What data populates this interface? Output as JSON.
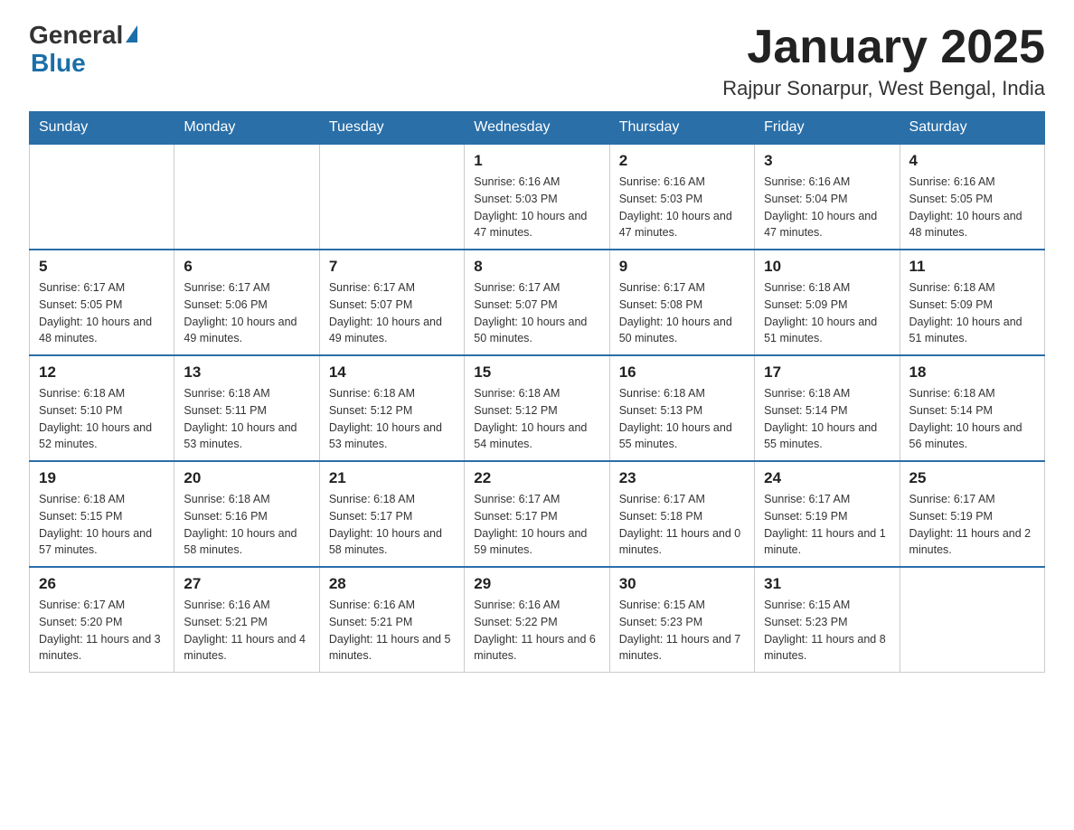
{
  "header": {
    "logo": {
      "general": "General",
      "blue": "Blue"
    },
    "title": "January 2025",
    "subtitle": "Rajpur Sonarpur, West Bengal, India"
  },
  "calendar": {
    "days_of_week": [
      "Sunday",
      "Monday",
      "Tuesday",
      "Wednesday",
      "Thursday",
      "Friday",
      "Saturday"
    ],
    "weeks": [
      [
        {
          "day": "",
          "info": ""
        },
        {
          "day": "",
          "info": ""
        },
        {
          "day": "",
          "info": ""
        },
        {
          "day": "1",
          "info": "Sunrise: 6:16 AM\nSunset: 5:03 PM\nDaylight: 10 hours and 47 minutes."
        },
        {
          "day": "2",
          "info": "Sunrise: 6:16 AM\nSunset: 5:03 PM\nDaylight: 10 hours and 47 minutes."
        },
        {
          "day": "3",
          "info": "Sunrise: 6:16 AM\nSunset: 5:04 PM\nDaylight: 10 hours and 47 minutes."
        },
        {
          "day": "4",
          "info": "Sunrise: 6:16 AM\nSunset: 5:05 PM\nDaylight: 10 hours and 48 minutes."
        }
      ],
      [
        {
          "day": "5",
          "info": "Sunrise: 6:17 AM\nSunset: 5:05 PM\nDaylight: 10 hours and 48 minutes."
        },
        {
          "day": "6",
          "info": "Sunrise: 6:17 AM\nSunset: 5:06 PM\nDaylight: 10 hours and 49 minutes."
        },
        {
          "day": "7",
          "info": "Sunrise: 6:17 AM\nSunset: 5:07 PM\nDaylight: 10 hours and 49 minutes."
        },
        {
          "day": "8",
          "info": "Sunrise: 6:17 AM\nSunset: 5:07 PM\nDaylight: 10 hours and 50 minutes."
        },
        {
          "day": "9",
          "info": "Sunrise: 6:17 AM\nSunset: 5:08 PM\nDaylight: 10 hours and 50 minutes."
        },
        {
          "day": "10",
          "info": "Sunrise: 6:18 AM\nSunset: 5:09 PM\nDaylight: 10 hours and 51 minutes."
        },
        {
          "day": "11",
          "info": "Sunrise: 6:18 AM\nSunset: 5:09 PM\nDaylight: 10 hours and 51 minutes."
        }
      ],
      [
        {
          "day": "12",
          "info": "Sunrise: 6:18 AM\nSunset: 5:10 PM\nDaylight: 10 hours and 52 minutes."
        },
        {
          "day": "13",
          "info": "Sunrise: 6:18 AM\nSunset: 5:11 PM\nDaylight: 10 hours and 53 minutes."
        },
        {
          "day": "14",
          "info": "Sunrise: 6:18 AM\nSunset: 5:12 PM\nDaylight: 10 hours and 53 minutes."
        },
        {
          "day": "15",
          "info": "Sunrise: 6:18 AM\nSunset: 5:12 PM\nDaylight: 10 hours and 54 minutes."
        },
        {
          "day": "16",
          "info": "Sunrise: 6:18 AM\nSunset: 5:13 PM\nDaylight: 10 hours and 55 minutes."
        },
        {
          "day": "17",
          "info": "Sunrise: 6:18 AM\nSunset: 5:14 PM\nDaylight: 10 hours and 55 minutes."
        },
        {
          "day": "18",
          "info": "Sunrise: 6:18 AM\nSunset: 5:14 PM\nDaylight: 10 hours and 56 minutes."
        }
      ],
      [
        {
          "day": "19",
          "info": "Sunrise: 6:18 AM\nSunset: 5:15 PM\nDaylight: 10 hours and 57 minutes."
        },
        {
          "day": "20",
          "info": "Sunrise: 6:18 AM\nSunset: 5:16 PM\nDaylight: 10 hours and 58 minutes."
        },
        {
          "day": "21",
          "info": "Sunrise: 6:18 AM\nSunset: 5:17 PM\nDaylight: 10 hours and 58 minutes."
        },
        {
          "day": "22",
          "info": "Sunrise: 6:17 AM\nSunset: 5:17 PM\nDaylight: 10 hours and 59 minutes."
        },
        {
          "day": "23",
          "info": "Sunrise: 6:17 AM\nSunset: 5:18 PM\nDaylight: 11 hours and 0 minutes."
        },
        {
          "day": "24",
          "info": "Sunrise: 6:17 AM\nSunset: 5:19 PM\nDaylight: 11 hours and 1 minute."
        },
        {
          "day": "25",
          "info": "Sunrise: 6:17 AM\nSunset: 5:19 PM\nDaylight: 11 hours and 2 minutes."
        }
      ],
      [
        {
          "day": "26",
          "info": "Sunrise: 6:17 AM\nSunset: 5:20 PM\nDaylight: 11 hours and 3 minutes."
        },
        {
          "day": "27",
          "info": "Sunrise: 6:16 AM\nSunset: 5:21 PM\nDaylight: 11 hours and 4 minutes."
        },
        {
          "day": "28",
          "info": "Sunrise: 6:16 AM\nSunset: 5:21 PM\nDaylight: 11 hours and 5 minutes."
        },
        {
          "day": "29",
          "info": "Sunrise: 6:16 AM\nSunset: 5:22 PM\nDaylight: 11 hours and 6 minutes."
        },
        {
          "day": "30",
          "info": "Sunrise: 6:15 AM\nSunset: 5:23 PM\nDaylight: 11 hours and 7 minutes."
        },
        {
          "day": "31",
          "info": "Sunrise: 6:15 AM\nSunset: 5:23 PM\nDaylight: 11 hours and 8 minutes."
        },
        {
          "day": "",
          "info": ""
        }
      ]
    ]
  }
}
